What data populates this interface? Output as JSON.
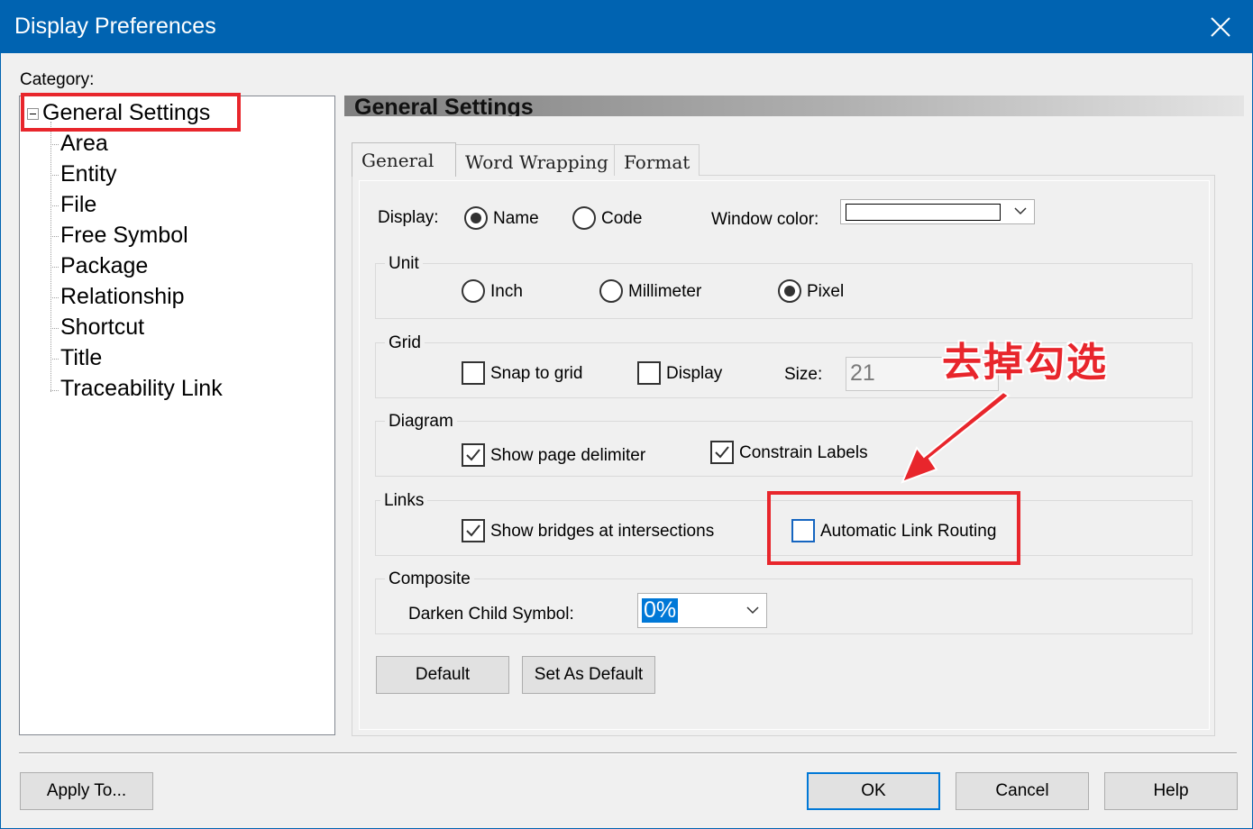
{
  "window": {
    "title": "Display Preferences"
  },
  "category": {
    "label": "Category:",
    "root": "General Settings",
    "children": [
      "Area",
      "Entity",
      "File",
      "Free Symbol",
      "Package",
      "Relationship",
      "Shortcut",
      "Title",
      "Traceability Link"
    ]
  },
  "panel": {
    "header": "General Settings"
  },
  "tabs": [
    {
      "label": "General",
      "active": true
    },
    {
      "label": "Word Wrapping",
      "active": false
    },
    {
      "label": "Format",
      "active": false
    }
  ],
  "display": {
    "label": "Display:",
    "options": [
      "Name",
      "Code"
    ],
    "selected": "Name",
    "window_color_label": "Window color:",
    "window_color_value": "#ffffff"
  },
  "unit": {
    "title": "Unit",
    "options": [
      "Inch",
      "Millimeter",
      "Pixel"
    ],
    "selected": "Pixel"
  },
  "grid": {
    "title": "Grid",
    "snap_label": "Snap to grid",
    "snap_checked": false,
    "display_label": "Display",
    "display_checked": false,
    "size_label": "Size:",
    "size_value": "21"
  },
  "diagram": {
    "title": "Diagram",
    "page_delimiter_label": "Show page delimiter",
    "page_delimiter_checked": true,
    "constrain_labels_label": "Constrain Labels",
    "constrain_labels_checked": true
  },
  "links": {
    "title": "Links",
    "bridges_label": "Show bridges at intersections",
    "bridges_checked": true,
    "auto_routing_label": "Automatic Link Routing",
    "auto_routing_checked": false
  },
  "composite": {
    "title": "Composite",
    "darken_label": "Darken Child Symbol:",
    "darken_value": "0%"
  },
  "panel_buttons": {
    "default": "Default",
    "set_as_default": "Set As Default"
  },
  "footer": {
    "apply_to": "Apply To...",
    "ok": "OK",
    "cancel": "Cancel",
    "help": "Help"
  },
  "annotation": {
    "text": "去掉勾选",
    "color": "#e8262c"
  },
  "colors": {
    "titlebar": "#0063b1",
    "highlight": "#0078d7",
    "annotation": "#e8262c"
  }
}
